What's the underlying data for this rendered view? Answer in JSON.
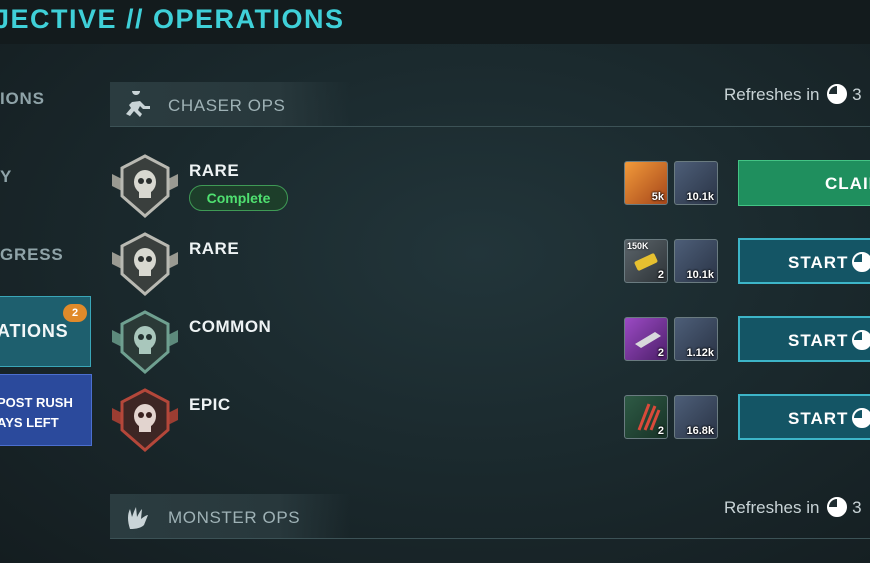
{
  "header": {
    "title": "JECTIVE // OPERATIONS"
  },
  "sidebar": {
    "items": [
      {
        "label": "IONS"
      },
      {
        "label": "Y"
      },
      {
        "label": "GRESS"
      }
    ],
    "active": {
      "label": "ATIONS",
      "badge": "2"
    },
    "event": {
      "line1": "POST RUSH",
      "line2": "AYS LEFT"
    }
  },
  "sections": [
    {
      "title": "CHASER OPS",
      "icon": "runner-icon",
      "refresh_label": "Refreshes in",
      "refresh_value": "3"
    },
    {
      "title": "MONSTER OPS",
      "icon": "claw-icon",
      "refresh_label": "Refreshes in",
      "refresh_value": "3"
    }
  ],
  "ops": [
    {
      "rarity": "RARE",
      "status": "Complete",
      "badge_color": "#b9b9b2",
      "rewards": [
        {
          "icon": "ticket-icon",
          "count": "5k",
          "tag": ""
        },
        {
          "icon": "gem-crate-icon",
          "count": "10.1k",
          "tag": ""
        }
      ],
      "button": "CLAIM"
    },
    {
      "rarity": "RARE",
      "status": "",
      "badge_color": "#b9b9b2",
      "rewards": [
        {
          "icon": "battery-icon",
          "count": "2",
          "tag": "150K"
        },
        {
          "icon": "gem-crate-icon",
          "count": "10.1k",
          "tag": ""
        }
      ],
      "button": "START"
    },
    {
      "rarity": "COMMON",
      "status": "",
      "badge_color": "#6fa090",
      "rewards": [
        {
          "icon": "metal-bar-icon",
          "count": "2",
          "tag": ""
        },
        {
          "icon": "gem-crate-icon",
          "count": "1.12k",
          "tag": ""
        }
      ],
      "button": "START"
    },
    {
      "rarity": "EPIC",
      "status": "",
      "badge_color": "#b4473a",
      "rewards": [
        {
          "icon": "claw-scratch-icon",
          "count": "2",
          "tag": ""
        },
        {
          "icon": "gem-crate-icon",
          "count": "16.8k",
          "tag": ""
        }
      ],
      "button": "START"
    }
  ]
}
